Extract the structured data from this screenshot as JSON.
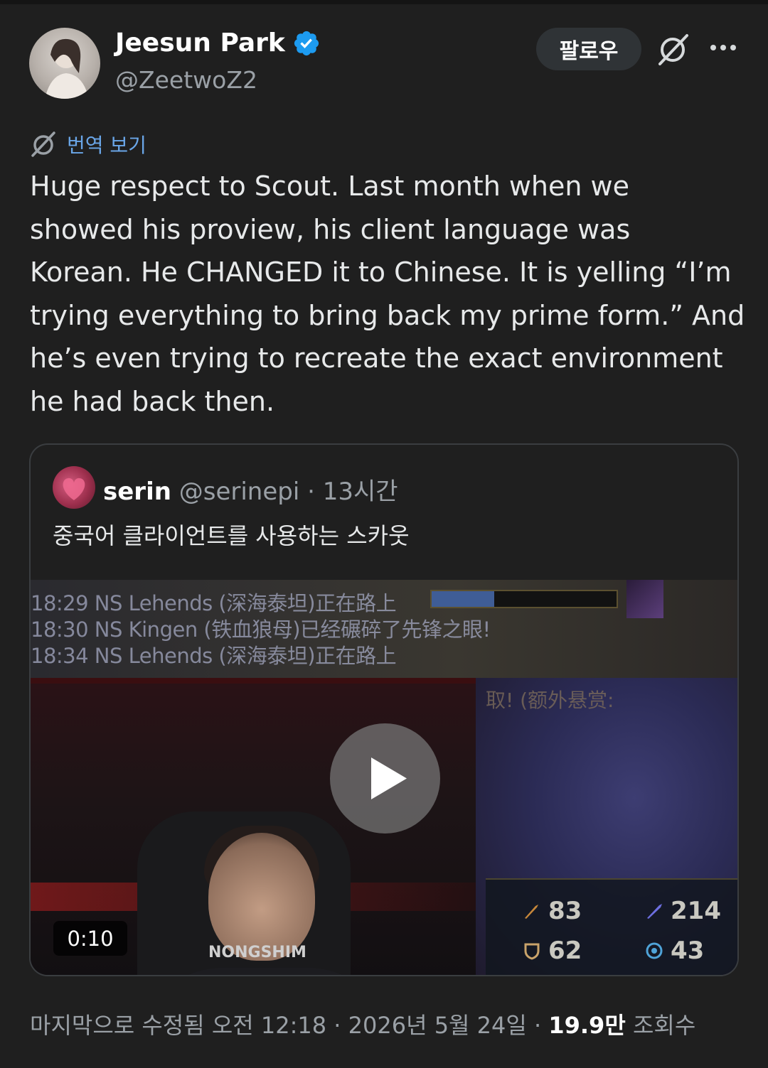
{
  "author": {
    "name": "Jeesun Park",
    "handle": "@ZeetwoZ2",
    "verified": true
  },
  "actions": {
    "follow_label": "팔로우",
    "grok_icon": "grok-icon",
    "more_icon": "more-icon"
  },
  "translate": {
    "label": "번역 보기",
    "icon": "translate-icon"
  },
  "tweet": {
    "text": "Huge respect to Scout. Last month when we\nshowed his proview, his client language was\nKorean. He CHANGED it to Chinese. It is yelling “I’m\ntrying everything to bring back my prime form.” And\nhe’s even trying to recreate the exact environment\nhe had back then."
  },
  "quote": {
    "name": "serin",
    "handle": "@serinepi",
    "separator": "·",
    "time": "13시간",
    "text": "중국어 클라이언트를 사용하는 스카웃",
    "video": {
      "duration": "0:10",
      "chat_lines": [
        "18:29 NS Lehends (深海泰坦)正在路上",
        "18:30 NS Kingen (铁血狼母)已经碾碎了先锋之眼!",
        "18:34 NS Lehends (深海泰坦)正在路上"
      ],
      "scene_text": "取! (额外悬赏:",
      "jersey_text": "NONGSHIM",
      "stats": [
        "83",
        "214",
        "62",
        "43"
      ]
    }
  },
  "footer": {
    "prefix": "마지막으로 수정됨 오전 12:18 · 2026년 5월 24일 · ",
    "views": "19.9만",
    "suffix": " 조회수"
  },
  "colors": {
    "background": "#1f1f1f",
    "link": "#6aa6e8",
    "verified": "#1d9bf0",
    "secondary_text": "#9aa0a6"
  }
}
